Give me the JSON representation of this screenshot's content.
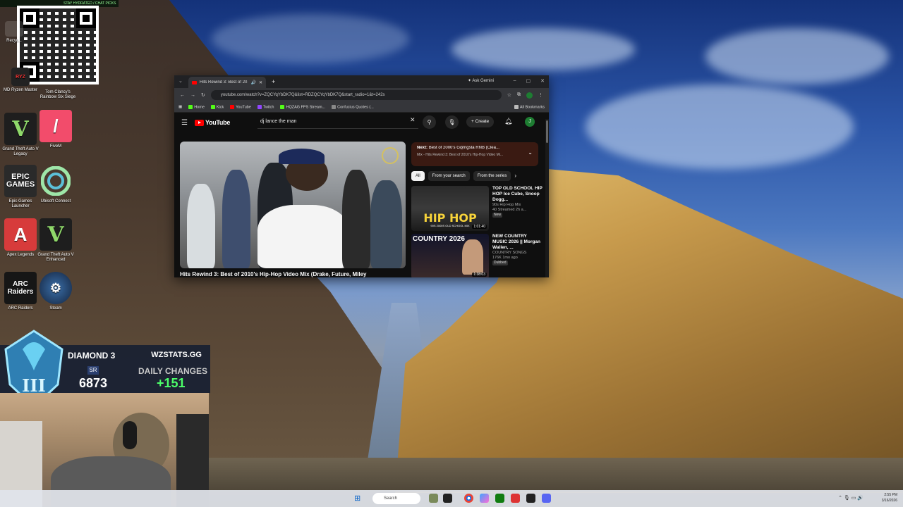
{
  "browser": {
    "tab_title": "Hits Rewind 3: Best of 2010'",
    "ask_gemini": "Ask Gemini",
    "url": "youtube.com/watch?v=ZQCYqYbDK7Q&list=RDZQCYqYbDK7Q&start_radio=1&t=242s",
    "bookmarks": [
      "Home",
      "Kick",
      "YouTube",
      "Twitch",
      "HQZAG FPS Stream...",
      "Confucius Quotes (..."
    ],
    "all_bookmarks": "All Bookmarks"
  },
  "youtube": {
    "logo": "YouTube",
    "search_query": "dj lance the man",
    "create": "Create",
    "avatar_letter": "J",
    "video_title": "Hits Rewind 3: Best of 2010's Hip-Hop Video Mix (Drake, Future, Miley",
    "next_label": "Next:",
    "next_title": "Best of 2000's G@ngsta RNB (Clea...",
    "next_sub": "Mix - Hits Rewind 3: Best of 2010's Hip-Hop Video Mi...",
    "chips": [
      "All",
      "From your search",
      "From the series"
    ],
    "recommendations": [
      {
        "title": "TOP OLD SCHOOL HIP HOP Ice Cube, Snoop Dogg...",
        "channel": "90s Hip Hop Mix",
        "meta": "40  Streamed 2h a...",
        "badge": "New",
        "duration": "1:01:40",
        "thumb_text": "HIP HOP",
        "thumb_sub": "90S 2000S OLD SCHOOL MIX"
      },
      {
        "title": "NEW COUNTRY MUSIC 2026 || Morgan Wallen, ...",
        "channel": "COUNTRY SONGS",
        "meta": "176K  1mo ago",
        "badge": "Dubbed",
        "duration": "1:38:03",
        "thumb_text": "COUNTRY 2026"
      }
    ]
  },
  "desktop_icons": [
    {
      "label": "Recyc..."
    },
    {
      "label": "MD Ryzen Master"
    },
    {
      "label": "Tom Clancy's Rainbow Six Siege"
    },
    {
      "label": "Grand Theft Auto V Legacy"
    },
    {
      "label": "FiveM"
    },
    {
      "label": "Epic Games Launcher"
    },
    {
      "label": "Ubisoft Connect"
    },
    {
      "label": "Apex Legends"
    },
    {
      "label": "Grand Theft Auto V Enhanced"
    },
    {
      "label": "ARC Raiders"
    },
    {
      "label": "Steam"
    }
  ],
  "overlay": {
    "top_text": "STAY HYDRATED / CHAT PICKS",
    "top_count": "150",
    "rank": "DIAMOND 3",
    "site": "WZSTATS.GG",
    "sr_label": "SR",
    "sr_value": "6873",
    "daily_label": "DAILY CHANGES",
    "daily_value": "+151"
  },
  "taskbar": {
    "search_placeholder": "Search",
    "time": "2:55 PM",
    "date": "3/16/2026"
  },
  "colors": {
    "yt_red": "#ff0000",
    "rank_green": "#4cff6a",
    "browser_bg": "#0f0f0f"
  }
}
